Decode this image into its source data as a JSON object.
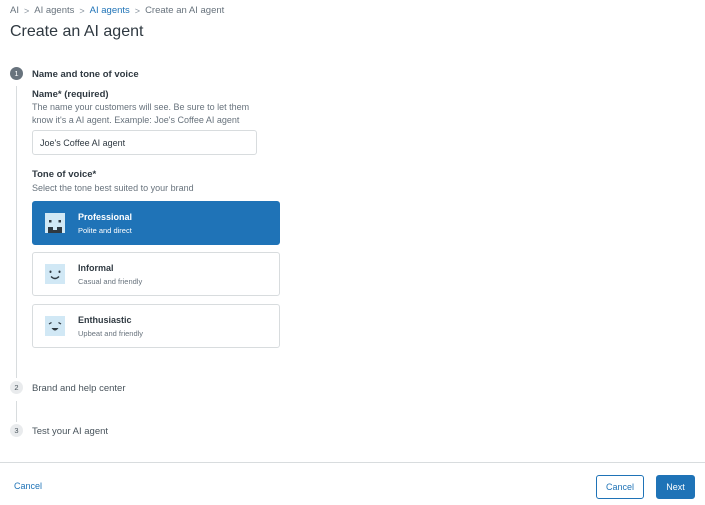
{
  "breadcrumb": {
    "items": [
      "AI",
      "AI agents",
      "AI agents",
      "Create an AI agent"
    ],
    "separator": ">"
  },
  "page": {
    "title": "Create an AI agent"
  },
  "steps": [
    {
      "number": "1",
      "label": "Name and tone of voice",
      "state": "active"
    },
    {
      "number": "2",
      "label": "Brand and help center",
      "state": "inactive"
    },
    {
      "number": "3",
      "label": "Test your AI agent",
      "state": "inactive"
    }
  ],
  "name_field": {
    "label": "Name* (required)",
    "hint_line1": "The name your customers will see. Be sure to let them",
    "hint_line2": "know it's a AI agent. Example: Joe's Coffee AI agent",
    "value": "Joe's Coffee AI agent"
  },
  "tone_field": {
    "label": "Tone of voice*",
    "hint": "Select the tone best suited to your brand",
    "options": [
      {
        "title": "Professional",
        "description": "Polite and direct",
        "icon": "professional-face-icon",
        "selected": true
      },
      {
        "title": "Informal",
        "description": "Casual and friendly",
        "icon": "smile-face-icon",
        "selected": false
      },
      {
        "title": "Enthusiastic",
        "description": "Upbeat and friendly",
        "icon": "grin-face-icon",
        "selected": false
      }
    ]
  },
  "footer": {
    "cancel_link": "Cancel",
    "cancel_button": "Cancel",
    "next_button": "Next"
  },
  "colors": {
    "accent": "#1f73b7",
    "icon_bg": "#d1e8f5",
    "text": "#2f3941",
    "muted": "#68737d",
    "border": "#d8dcde"
  }
}
